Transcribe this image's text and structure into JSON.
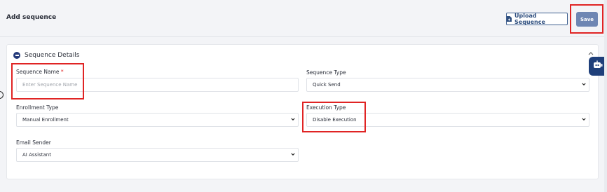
{
  "header": {
    "title": "Add sequence",
    "upload_label": "Upload Sequence",
    "save_label": "Save"
  },
  "section": {
    "title": "Sequence Details"
  },
  "fields": {
    "sequence_name": {
      "label": "Sequence Name",
      "required_mark": "*",
      "placeholder": "Enter Sequence Name"
    },
    "sequence_type": {
      "label": "Sequence Type",
      "value": "Quick Send"
    },
    "enrollment_type": {
      "label": "Enrollment Type",
      "value": "Manual Enrollment"
    },
    "execution_type": {
      "label": "Execution Type",
      "value": "Disable Execution"
    },
    "email_sender": {
      "label": "Email Sender",
      "value": "AI Assistant"
    }
  },
  "icons": [
    "document-upload-icon",
    "collapse-minus-icon",
    "chevron-up-icon",
    "chevron-down-icon",
    "chat-bot-icon"
  ],
  "colors": {
    "primary": "#243a7a",
    "save_button": "#6e86b3",
    "highlight": "#e02424",
    "required": "#e02424"
  }
}
